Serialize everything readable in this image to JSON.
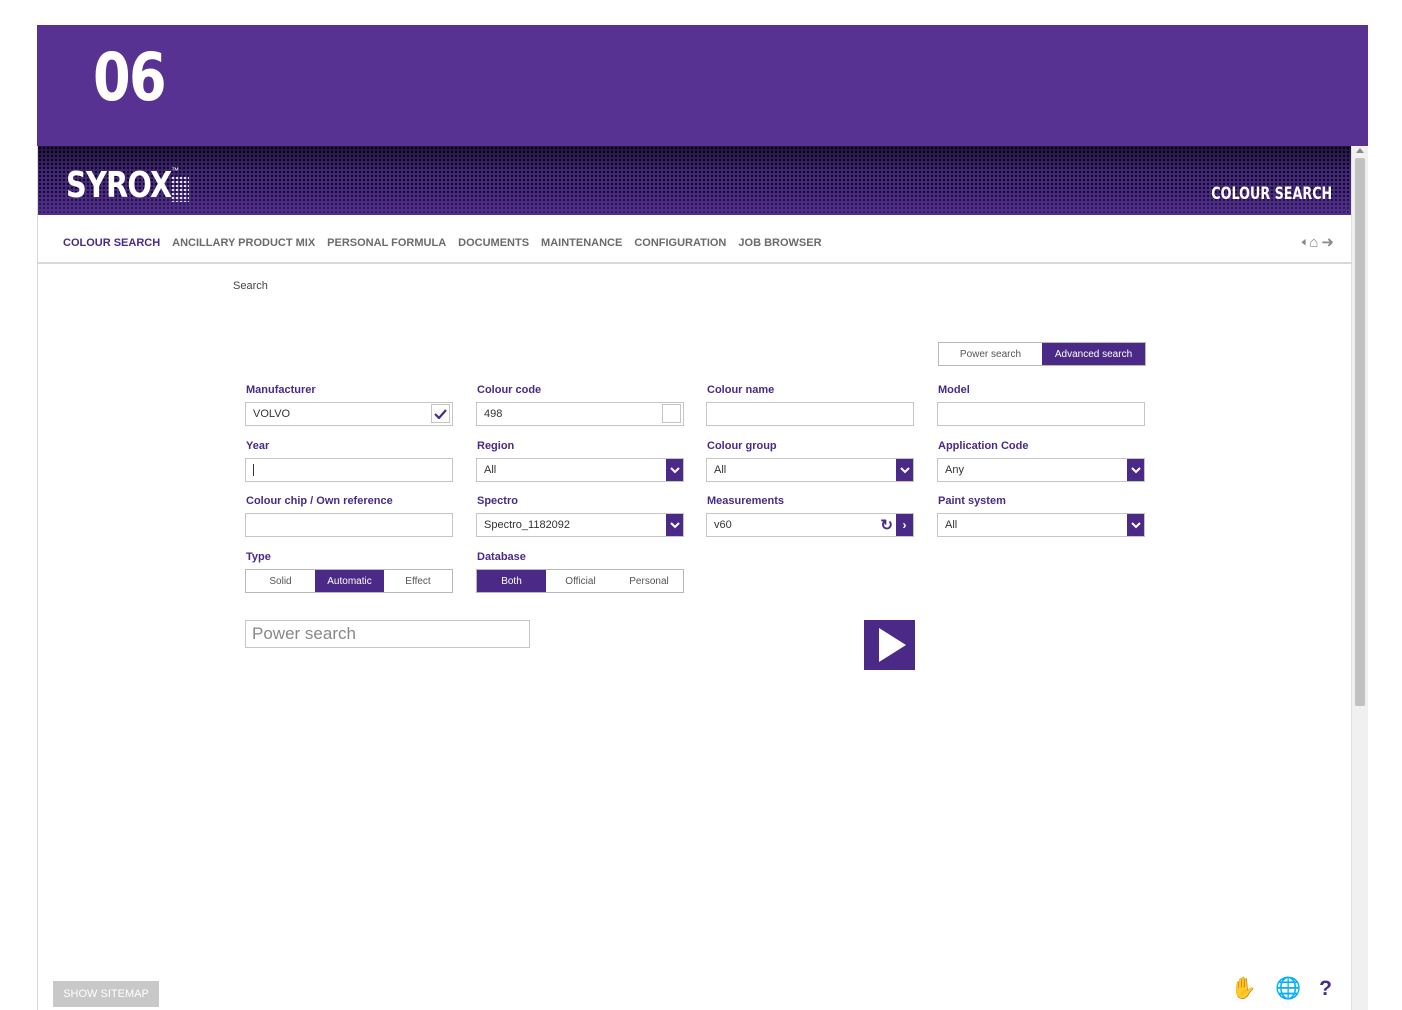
{
  "banner": {
    "number": "06"
  },
  "header": {
    "logo": "SYROX",
    "logo_tm": "™",
    "title": "COLOUR SEARCH"
  },
  "nav": {
    "items": [
      {
        "label": "COLOUR SEARCH",
        "active": true
      },
      {
        "label": "ANCILLARY PRODUCT MIX"
      },
      {
        "label": "PERSONAL FORMULA"
      },
      {
        "label": "DOCUMENTS"
      },
      {
        "label": "MAINTENANCE"
      },
      {
        "label": "CONFIGURATION"
      },
      {
        "label": "JOB BROWSER"
      }
    ],
    "icons": [
      "back-arrow-icon",
      "home-icon",
      "logout-icon"
    ]
  },
  "breadcrumb": "Search",
  "search_mode": {
    "options": [
      "Power search",
      "Advanced search"
    ],
    "selected": "Advanced search"
  },
  "form": {
    "manufacturer": {
      "label": "Manufacturer",
      "value": "VOLVO"
    },
    "colour_code": {
      "label": "Colour code",
      "value": "498"
    },
    "colour_name": {
      "label": "Colour name",
      "value": ""
    },
    "model": {
      "label": "Model",
      "value": ""
    },
    "year": {
      "label": "Year",
      "value": ""
    },
    "region": {
      "label": "Region",
      "value": "All"
    },
    "colour_group": {
      "label": "Colour group",
      "value": "All"
    },
    "application_code": {
      "label": "Application Code",
      "value": "Any"
    },
    "colour_chip": {
      "label": "Colour chip / Own reference",
      "value": ""
    },
    "spectro": {
      "label": "Spectro",
      "value": "Spectro_1182092"
    },
    "measurements": {
      "label": "Measurements",
      "value": "v60"
    },
    "paint_system": {
      "label": "Paint system",
      "value": "All"
    },
    "type": {
      "label": "Type",
      "options": [
        "Solid",
        "Automatic",
        "Effect"
      ],
      "selected": "Automatic"
    },
    "database": {
      "label": "Database",
      "options": [
        "Both",
        "Official",
        "Personal"
      ],
      "selected": "Both"
    }
  },
  "power_search": {
    "placeholder": "Power search"
  },
  "footer": {
    "sitemap_label": "SHOW SITEMAP",
    "icons": [
      "touch-icon",
      "globe-icon",
      "help-icon"
    ]
  },
  "colors": {
    "brand": "#573293",
    "accent": "#4a2a86"
  }
}
